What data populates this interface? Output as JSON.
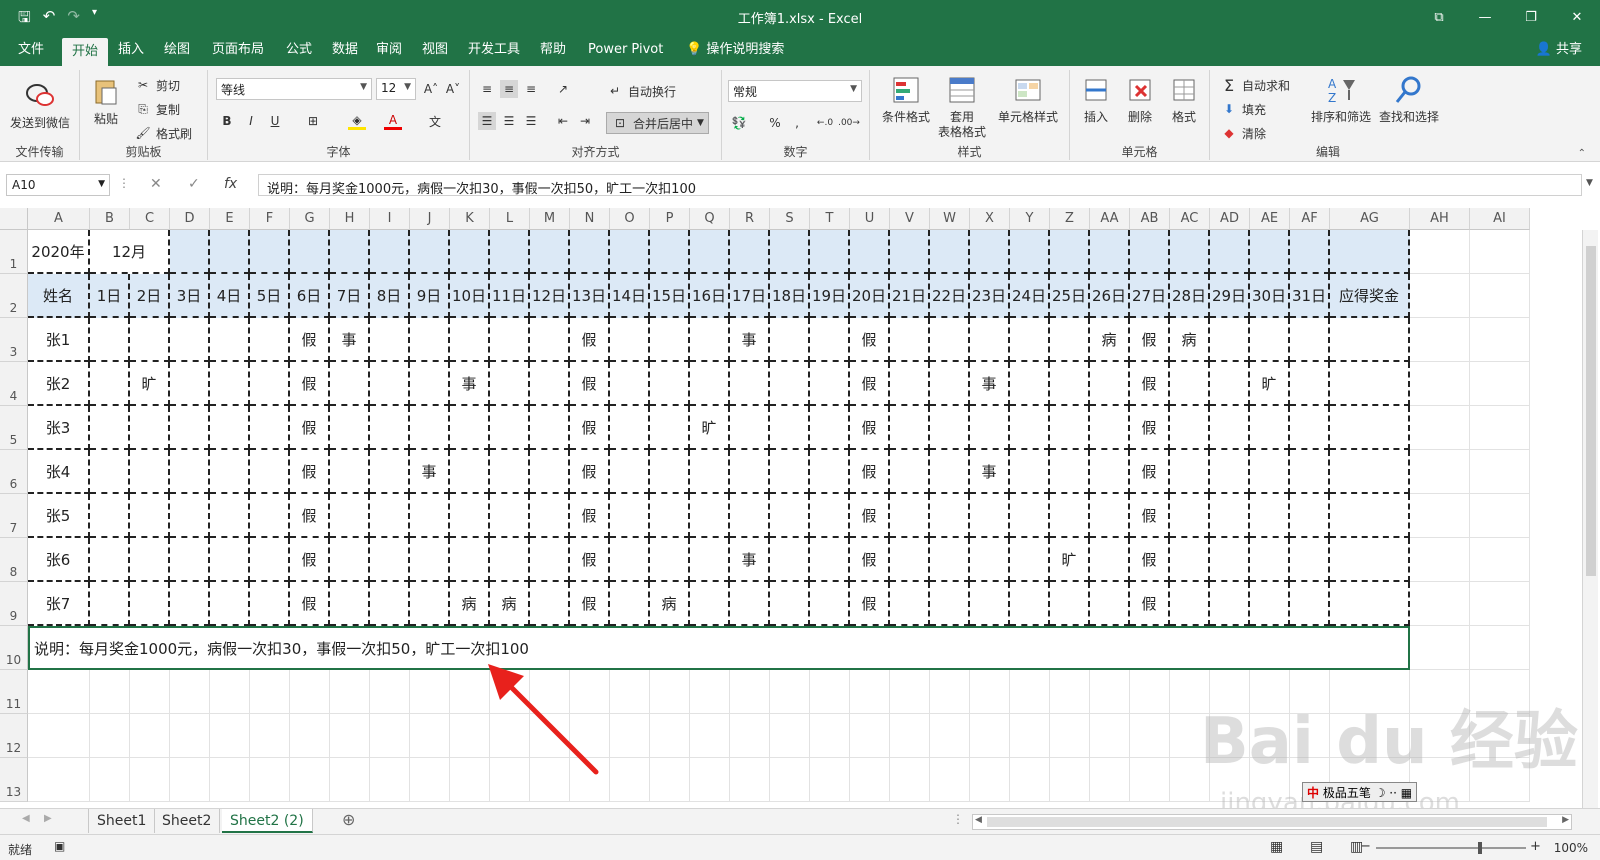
{
  "window": {
    "title": "工作簿1.xlsx  -  Excel",
    "share": "共享"
  },
  "tabs": [
    "文件",
    "开始",
    "插入",
    "绘图",
    "页面布局",
    "公式",
    "数据",
    "审阅",
    "视图",
    "开发工具",
    "帮助",
    "Power Pivot",
    "操作说明搜索"
  ],
  "ribbon": {
    "wechat": "发送到微信",
    "file_transfer": "文件传输",
    "paste": "粘贴",
    "cut": "剪切",
    "copy": "复制",
    "format_painter": "格式刷",
    "clipboard": "剪贴板",
    "font_name": "等线",
    "font_size": "12",
    "font_group": "字体",
    "wrap_text": "自动换行",
    "merge_center": "合并后居中",
    "alignment": "对齐方式",
    "number_format": "常规",
    "number_group": "数字",
    "conditional": "条件格式",
    "table_format_1": "套用",
    "table_format_2": "表格格式",
    "cell_style": "单元格样式",
    "styles": "样式",
    "insert": "插入",
    "delete": "删除",
    "format": "格式",
    "cells": "单元格",
    "autosum": "自动求和",
    "fill": "填充",
    "clear": "清除",
    "sort_filter": "排序和筛选",
    "find_select": "查找和选择",
    "editing": "编辑"
  },
  "formula_bar": {
    "name_box": "A10",
    "content": "说明：每月奖金1000元，病假一次扣30，事假一次扣50，旷工一次扣100"
  },
  "columns": [
    "A",
    "B",
    "C",
    "D",
    "E",
    "F",
    "G",
    "H",
    "I",
    "J",
    "K",
    "L",
    "M",
    "N",
    "O",
    "P",
    "Q",
    "R",
    "S",
    "T",
    "U",
    "V",
    "W",
    "X",
    "Y",
    "Z",
    "AA",
    "AB",
    "AC",
    "AD",
    "AE",
    "AF",
    "AG",
    "AH",
    "AI"
  ],
  "rows": [
    "1",
    "2",
    "3",
    "4",
    "5",
    "6",
    "7",
    "8",
    "9",
    "10",
    "11",
    "12",
    "13"
  ],
  "sheet": {
    "year": "2020年",
    "month": "12月",
    "name_header": "姓名",
    "days": [
      "1日",
      "2日",
      "3日",
      "4日",
      "5日",
      "6日",
      "7日",
      "8日",
      "9日",
      "10日",
      "11日",
      "12日",
      "13日",
      "14日",
      "15日",
      "16日",
      "17日",
      "18日",
      "19日",
      "20日",
      "21日",
      "22日",
      "23日",
      "24日",
      "25日",
      "26日",
      "27日",
      "28日",
      "29日",
      "30日",
      "31日"
    ],
    "bonus_header": "应得奖金",
    "employees": [
      {
        "name": "张1",
        "marks": {
          "6": "假",
          "7": "事",
          "13": "假",
          "17": "事",
          "20": "假",
          "26": "病",
          "27": "假",
          "28": "病"
        }
      },
      {
        "name": "张2",
        "marks": {
          "2": "旷",
          "6": "假",
          "10": "事",
          "13": "假",
          "20": "假",
          "23": "事",
          "27": "假",
          "30": "旷"
        }
      },
      {
        "name": "张3",
        "marks": {
          "6": "假",
          "13": "假",
          "16": "旷",
          "20": "假",
          "27": "假"
        }
      },
      {
        "name": "张4",
        "marks": {
          "6": "假",
          "9": "事",
          "13": "假",
          "20": "假",
          "23": "事",
          "27": "假"
        }
      },
      {
        "name": "张5",
        "marks": {
          "6": "假",
          "13": "假",
          "20": "假",
          "27": "假"
        }
      },
      {
        "name": "张6",
        "marks": {
          "6": "假",
          "13": "假",
          "17": "事",
          "20": "假",
          "25": "旷",
          "27": "假"
        }
      },
      {
        "name": "张7",
        "marks": {
          "6": "假",
          "10": "病",
          "11": "病",
          "13": "假",
          "15": "病",
          "20": "假",
          "27": "假"
        }
      }
    ],
    "note": "说明：每月奖金1000元，病假一次扣30，事假一次扣50，旷工一次扣100"
  },
  "sheet_tabs": [
    "Sheet1",
    "Sheet2",
    "Sheet2 (2)"
  ],
  "status": {
    "ready": "就绪",
    "zoom": "100%"
  },
  "watermark": {
    "brand": "Bai du 经验",
    "url": "jingyan.baidu.com",
    "ime": "极品五笔"
  },
  "colors": {
    "excel_green": "#217346",
    "header_fill": "#dce9f6",
    "arrow": "#e8211c"
  }
}
